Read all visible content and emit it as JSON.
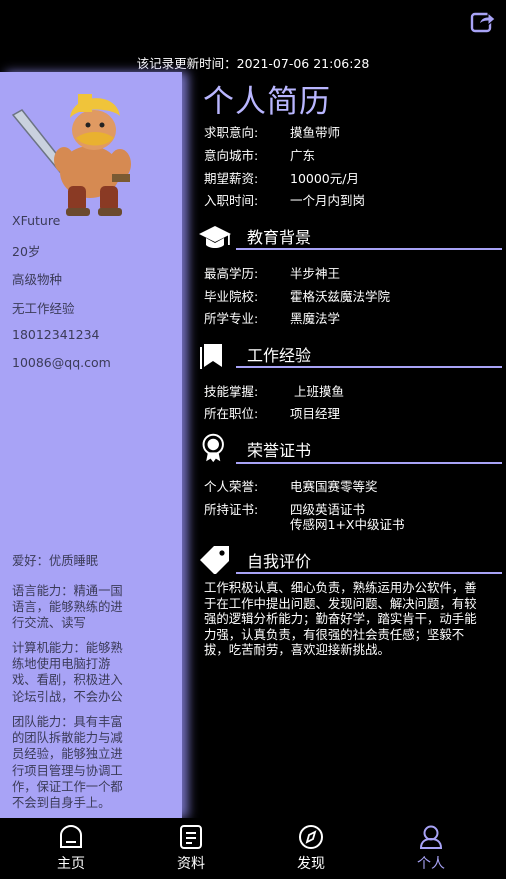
{
  "header": {
    "updated_text": "该记录更新时间：2021-07-06 21:06:28"
  },
  "profile": {
    "name": "XFuture",
    "age": "20岁",
    "class": "高级物种",
    "experience": "无工作经验",
    "phone": "18012341234",
    "email": "10086@qq.com"
  },
  "sidebar": {
    "hobby": "爱好：优质睡眠",
    "language": "语言能力：精通一国语言，能够熟练的进行交流、读写",
    "computer": "计算机能力：能够熟练地使用电脑打游戏、看剧，积极进入论坛引战，不会办公",
    "team": "团队能力：具有丰富的团队拆散能力与减员经验，能够独立进行项目管理与协调工作，保证工作一个都不会到自身手上。"
  },
  "resume": {
    "title": "个人简历",
    "intent": [
      {
        "k": "求职意向:",
        "v": "摸鱼带师"
      },
      {
        "k": "意向城市:",
        "v": "广东"
      },
      {
        "k": "期望薪资:",
        "v": "10000元/月"
      },
      {
        "k": "入职时间:",
        "v": "一个月内到岗"
      }
    ],
    "education": {
      "title": "教育背景",
      "rows": [
        {
          "k": "最高学历:",
          "v": "半步神王"
        },
        {
          "k": "毕业院校:",
          "v": "霍格沃兹魔法学院"
        },
        {
          "k": "所学专业:",
          "v": "黑魔法学"
        }
      ]
    },
    "work": {
      "title": "工作经验",
      "rows": [
        {
          "k": "技能掌握:",
          "v": " 上班摸鱼"
        },
        {
          "k": "所在职位:",
          "v": "项目经理"
        }
      ]
    },
    "honors": {
      "title": "荣誉证书",
      "rows": [
        {
          "k": "个人荣誉:",
          "v": "电赛国赛零等奖"
        },
        {
          "k": "所持证书:",
          "v": "四级英语证书"
        },
        {
          "k": "",
          "v": "传感网1+X中级证书"
        }
      ]
    },
    "self_eval": {
      "title": "自我评价",
      "text": "工作积极认真、细心负责，熟练运用办公软件，善于在工作中提出问题、发现问题、解决问题，有较强的逻辑分析能力；勤奋好学，踏实肯干，动手能力强，认真负责，有很强的社会责任感；坚毅不拔，吃苦耐劳，喜欢迎接新挑战。"
    }
  },
  "nav": {
    "items": [
      {
        "label": "主页",
        "icon": "home-icon"
      },
      {
        "label": "资料",
        "icon": "document-icon"
      },
      {
        "label": "发现",
        "icon": "compass-icon"
      },
      {
        "label": "个人",
        "icon": "person-icon"
      }
    ],
    "active": "个人"
  },
  "colors": {
    "accent": "#a8a3f6",
    "title": "#b9b6ff",
    "background": "#000000"
  }
}
